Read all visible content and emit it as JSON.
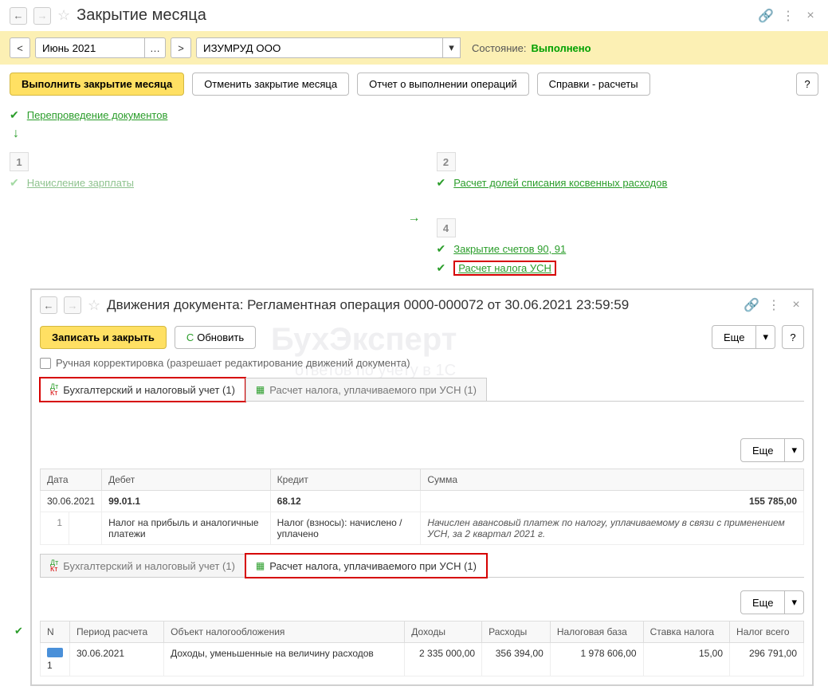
{
  "main": {
    "title": "Закрытие месяца",
    "period": "Июнь 2021",
    "org": "ИЗУМРУД ООО",
    "state_label": "Состояние:",
    "state_value": "Выполнено",
    "btn_execute": "Выполнить закрытие месяца",
    "btn_cancel": "Отменить закрытие месяца",
    "btn_report": "Отчет о выполнении операций",
    "btn_calcs": "Справки - расчеты",
    "btn_help": "?",
    "step_repost": "Перепроведение документов",
    "col1_num": "1",
    "col1_item": "Начисление зарплаты",
    "col2_num": "2",
    "col2_item": "Расчет долей списания косвенных расходов",
    "col4_num": "4",
    "col4_item1": "Закрытие счетов 90, 91",
    "col4_item2": "Расчет налога УСН"
  },
  "inner": {
    "title": "Движения документа: Регламентная операция 0000-000072 от 30.06.2021 23:59:59",
    "btn_save": "Записать и закрыть",
    "btn_refresh": "Обновить",
    "btn_more": "Еще",
    "btn_help": "?",
    "checkbox_label": "Ручная корректировка (разрешает редактирование движений документа)",
    "tab1": "Бухгалтерский и налоговый учет (1)",
    "tab2": "Расчет налога, уплачиваемого при УСН (1)",
    "watermark1": "БухЭксперт",
    "watermark2": "ответов по учету в 1С"
  },
  "table1": {
    "h_date": "Дата",
    "h_debit": "Дебет",
    "h_credit": "Кредит",
    "h_sum": "Сумма",
    "r_date": "30.06.2021",
    "r_num": "1",
    "r_debit": "99.01.1",
    "r_debit_desc": "Налог на прибыль и аналогичные платежи",
    "r_credit": "68.12",
    "r_credit_desc": "Налог (взносы): начислено / уплачено",
    "r_sum": "155 785,00",
    "r_sum_desc": "Начислен авансовый платеж по налогу, уплачиваемому в связи с применением УСН, за 2 квартал 2021 г."
  },
  "table2": {
    "h_n": "N",
    "h_period": "Период расчета",
    "h_object": "Объект налогообложения",
    "h_income": "Доходы",
    "h_expense": "Расходы",
    "h_base": "Налоговая база",
    "h_rate": "Ставка налога",
    "h_tax": "Налог всего",
    "r_n": "1",
    "r_period": "30.06.2021",
    "r_object": "Доходы, уменьшенные на величину расходов",
    "r_income": "2 335 000,00",
    "r_expense": "356 394,00",
    "r_base": "1 978 606,00",
    "r_rate": "15,00",
    "r_tax": "296 791,00"
  }
}
